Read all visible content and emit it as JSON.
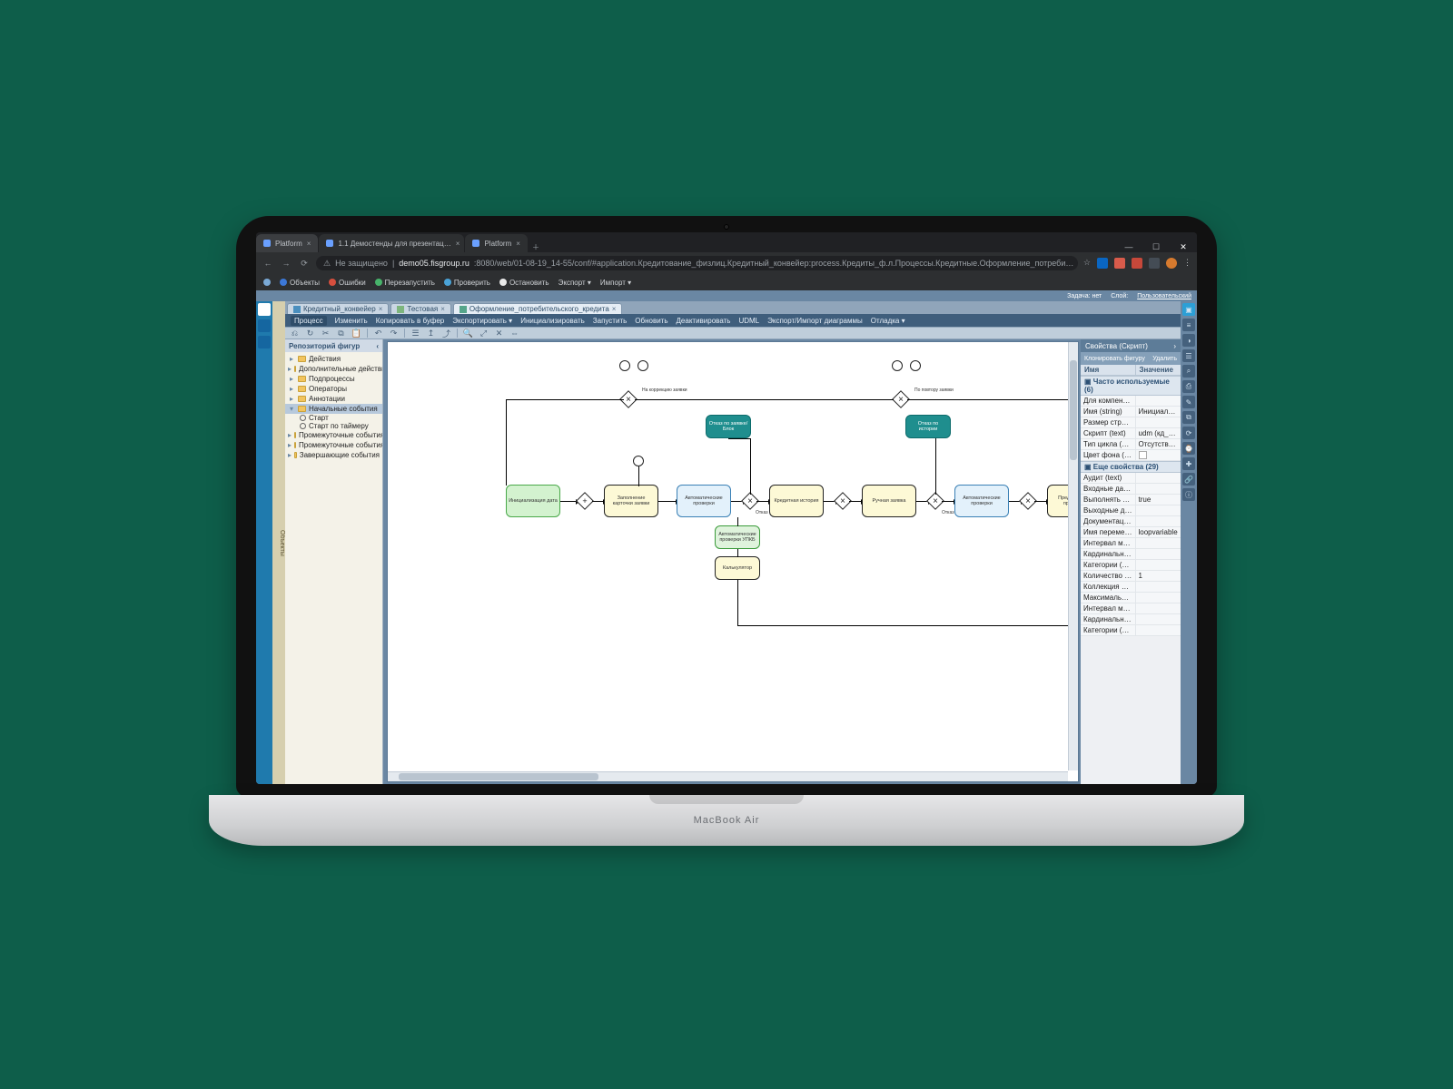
{
  "chrome": {
    "tabs": [
      {
        "title": "Platform",
        "active": true
      },
      {
        "title": "1.1 Демостенды для презентац…",
        "active": false
      },
      {
        "title": "Platform",
        "active": false
      }
    ],
    "nav": {
      "back": "←",
      "forward": "→",
      "reload": "⟳"
    },
    "security_label": "Не защищено",
    "url_host": "demo05.fisgroup.ru",
    "url_path": ":8080/web/01-08-19_14-55/conf/#application.Кредитование_физлиц.Кредитный_конвейер:process.Кредиты_ф.л.Процессы.Кредитные.Оформление_потреби…",
    "window": {
      "min": "—",
      "max": "☐",
      "close": "✕"
    }
  },
  "bookmarks": [
    {
      "label": "Объекты",
      "color": "#3c78d8"
    },
    {
      "label": "Ошибки",
      "color": "#d64f3e"
    },
    {
      "label": "Перезапустить",
      "color": "#47b36a"
    },
    {
      "label": "Проверить",
      "color": "#4aa3d8"
    },
    {
      "label": "Остановить",
      "color": "#e8e8e8"
    },
    {
      "label": "Экспорт ▾",
      "color": "#e8e8e8"
    },
    {
      "label": "Импорт ▾",
      "color": "#e8e8e8"
    }
  ],
  "app_status": {
    "task": "Задача: нет",
    "layer_label": "Слой:",
    "layer_value": "Пользовательский"
  },
  "vert_tab": "Объекты",
  "doc_tabs": [
    {
      "label": "Кредитный_конвейер"
    },
    {
      "label": "Тестовая"
    },
    {
      "label": "Оформление_потребительского_кредита",
      "active": true
    }
  ],
  "menu": [
    "Процесс",
    "Изменить",
    "Копировать в буфер",
    "Экспортировать ▾",
    "Инициализировать",
    "Запустить",
    "Обновить",
    "Деактивировать",
    "UDML",
    "Экспорт/Импорт диаграммы",
    "Отладка ▾"
  ],
  "toolbar_icons": [
    "⎌",
    "↻",
    "✂",
    "⧉",
    "📋",
    "|",
    "↶",
    "↷",
    "|",
    "☰",
    "↥",
    "⤴",
    "|",
    "🔍",
    "⤢",
    "✕",
    "⇔"
  ],
  "repo": {
    "title": "Репозиторий фигур",
    "folders": [
      {
        "label": "Действия"
      },
      {
        "label": "Дополнительные действия"
      },
      {
        "label": "Подпроцессы"
      },
      {
        "label": "Операторы"
      },
      {
        "label": "Аннотации"
      },
      {
        "label": "Начальные события",
        "open": true,
        "children": [
          {
            "label": "Старт"
          },
          {
            "label": "Старт по таймеру"
          }
        ]
      },
      {
        "label": "Промежуточные события - о…"
      },
      {
        "label": "Промежуточные события - с…"
      },
      {
        "label": "Завершающие события"
      }
    ]
  },
  "bpmn": {
    "labels": {
      "t1": "Инициализация дата",
      "t2": "Заполнение карточки заявки",
      "t3": "Автоматические проверки",
      "t4": "Кредитная история",
      "t5": "Ручная заявка",
      "t6": "Автоматические проверки",
      "t7": "Предварительное предложение",
      "t8": "Отказ по заявке/Блок",
      "t9": "Отказ по истории",
      "t10": "Автоматические проверки УПКБ",
      "t11": "Калькулятор",
      "l1": "На коррекцию заявки",
      "l2": "По повтору заявки",
      "l3": "Отказ",
      "l4": "Отказ"
    }
  },
  "props": {
    "title": "Свойства (Скрипт)",
    "actions": {
      "clone": "Клонировать фигуру",
      "delete": "Удалить"
    },
    "head": {
      "k": "Имя",
      "v": "Значение"
    },
    "group_used": "Часто используемые (6)",
    "used": [
      {
        "k": "Для компенса…",
        "v": ""
      },
      {
        "k": "Имя (string)",
        "v": "Инициализац…"
      },
      {
        "k": "Размер стран…",
        "v": ""
      },
      {
        "k": "Скрипт (text)",
        "v": "udm (кд_проц…"
      },
      {
        "k": "Тип цикла (ch…",
        "v": "Отсутствует"
      },
      {
        "k": "Цвет фона (co…",
        "v": "",
        "swatch": true
      }
    ],
    "group_more": "Еще свойства (29)",
    "more": [
      {
        "k": "Аудит (text)",
        "v": ""
      },
      {
        "k": "Входные данн…",
        "v": ""
      },
      {
        "k": "Выполнять в…",
        "v": "true"
      },
      {
        "k": "Выходные да…",
        "v": ""
      },
      {
        "k": "Документация…",
        "v": ""
      },
      {
        "k": "Имя перемен…",
        "v": "loopvariable"
      },
      {
        "k": "Интервал ме…",
        "v": ""
      },
      {
        "k": "Кардинально…",
        "v": ""
      },
      {
        "k": "Категории (str…",
        "v": ""
      },
      {
        "k": "Количество п…",
        "v": "1"
      },
      {
        "k": "Коллекция дл…",
        "v": ""
      },
      {
        "k": "Максимально…",
        "v": ""
      },
      {
        "k": "Интервал ме…",
        "v": ""
      },
      {
        "k": "Кардинально…",
        "v": ""
      },
      {
        "k": "Категории (str…",
        "v": ""
      }
    ]
  },
  "laptop_label": "MacBook Air"
}
